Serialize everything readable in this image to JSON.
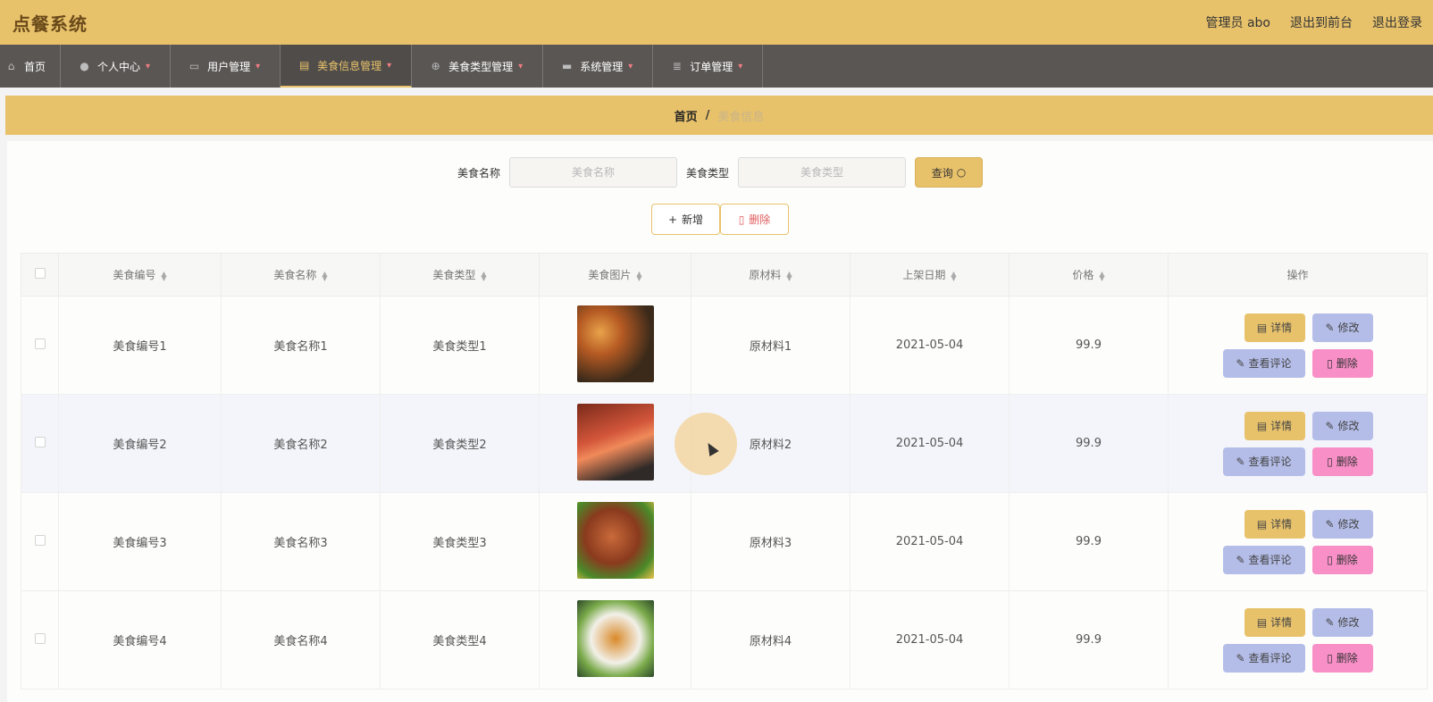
{
  "app": {
    "title": "点餐系统"
  },
  "header": {
    "admin": "管理员 abo",
    "to_front": "退出到前台",
    "logout": "退出登录"
  },
  "nav": {
    "items": [
      {
        "label": "首页",
        "icon": "home-icon"
      },
      {
        "label": "个人中心",
        "icon": "user-icon"
      },
      {
        "label": "用户管理",
        "icon": "chat-icon"
      },
      {
        "label": "美食信息管理",
        "icon": "clipboard-icon"
      },
      {
        "label": "美食类型管理",
        "icon": "aim-icon"
      },
      {
        "label": "系统管理",
        "icon": "message-icon"
      },
      {
        "label": "订单管理",
        "icon": "list-icon"
      }
    ]
  },
  "breadcrumb": {
    "home": "首页",
    "sep": "/",
    "current": "美食信息"
  },
  "search": {
    "name_label": "美食名称",
    "name_placeholder": "美食名称",
    "type_label": "美食类型",
    "type_placeholder": "美食类型",
    "query_label": "查询"
  },
  "toolbar": {
    "add_label": "新增",
    "delete_label": "删除"
  },
  "table": {
    "headers": [
      "美食编号",
      "美食名称",
      "美食类型",
      "美食图片",
      "原材料",
      "上架日期",
      "价格",
      "操作"
    ],
    "rows": [
      {
        "code": "美食编号1",
        "name": "美食名称1",
        "type": "美食类型1",
        "material": "原材料1",
        "date": "2021-05-04",
        "price": "99.9"
      },
      {
        "code": "美食编号2",
        "name": "美食名称2",
        "type": "美食类型2",
        "material": "原材料2",
        "date": "2021-05-04",
        "price": "99.9"
      },
      {
        "code": "美食编号3",
        "name": "美食名称3",
        "type": "美食类型3",
        "material": "原材料3",
        "date": "2021-05-04",
        "price": "99.9"
      },
      {
        "code": "美食编号4",
        "name": "美食名称4",
        "type": "美食类型4",
        "material": "原材料4",
        "date": "2021-05-04",
        "price": "99.9"
      }
    ],
    "ops": {
      "detail": "详情",
      "edit": "修改",
      "review": "查看评论",
      "delete": "删除"
    }
  },
  "colors": {
    "accent": "#e8c26b",
    "nav_bg": "#5a5654",
    "edit": "#b4bde8",
    "delete": "#f88fc7"
  }
}
